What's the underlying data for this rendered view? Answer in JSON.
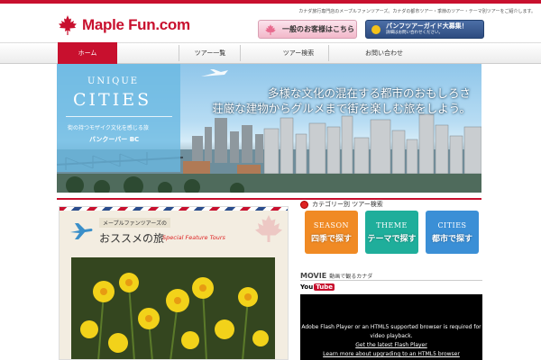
{
  "header": {
    "tagline": "カナダ旅行専門店のメープルファンツアーズ。カナダの都市ツアー・季節のツアー・テーマ別ツアーをご紹介します。",
    "logo_text": "Maple Fun.com",
    "customer_button": "一般のお客様はこちら",
    "pamphlet_line1": "パンフツアーガイド大募集！",
    "pamphlet_line2": "詳細はお問い合わせください。"
  },
  "nav": {
    "items": [
      {
        "label": "ホーム"
      },
      {
        "label": "ツアー一覧"
      },
      {
        "label": "ツアー検索"
      },
      {
        "label": "お問い合わせ"
      }
    ]
  },
  "hero": {
    "badge_unique": "UNIQUE",
    "badge_cities": "CITIES",
    "badge_subtitle": "街の持つモザイク文化を感じる旅",
    "badge_city": "バンクーバー BC",
    "headline1": "多様な文化の混在する都市のおもしろさ",
    "headline2": "荘厳な建物からグルメまで街を楽しむ旅をしよう。"
  },
  "feature": {
    "eyebrow": "メープルファンツアーズの",
    "title": "おススメの旅",
    "subtitle": "Special Feature Tours"
  },
  "categories": {
    "title": "カテゴリー別 ツアー検索",
    "buttons": [
      {
        "en": "SEASON",
        "jp": "四季で探す",
        "color": "#f08a24"
      },
      {
        "en": "THEME",
        "jp": "テーマで探す",
        "color": "#1fae9b"
      },
      {
        "en": "CITIES",
        "jp": "都市で探す",
        "color": "#3b8fd6"
      }
    ]
  },
  "movie": {
    "title_en": "MOVIE",
    "title_jp": "動画で観るカナダ",
    "youtube_you": "You",
    "youtube_tube": "Tube",
    "message": "Adobe Flash Player or an HTML5 supported browser is required for video playback.",
    "link1": "Get the latest Flash Player",
    "link2": "Learn more about upgrading to an HTML5 browser"
  },
  "colors": {
    "brand_red": "#c8102e",
    "pamphlet_blue": "#2d4c80"
  }
}
